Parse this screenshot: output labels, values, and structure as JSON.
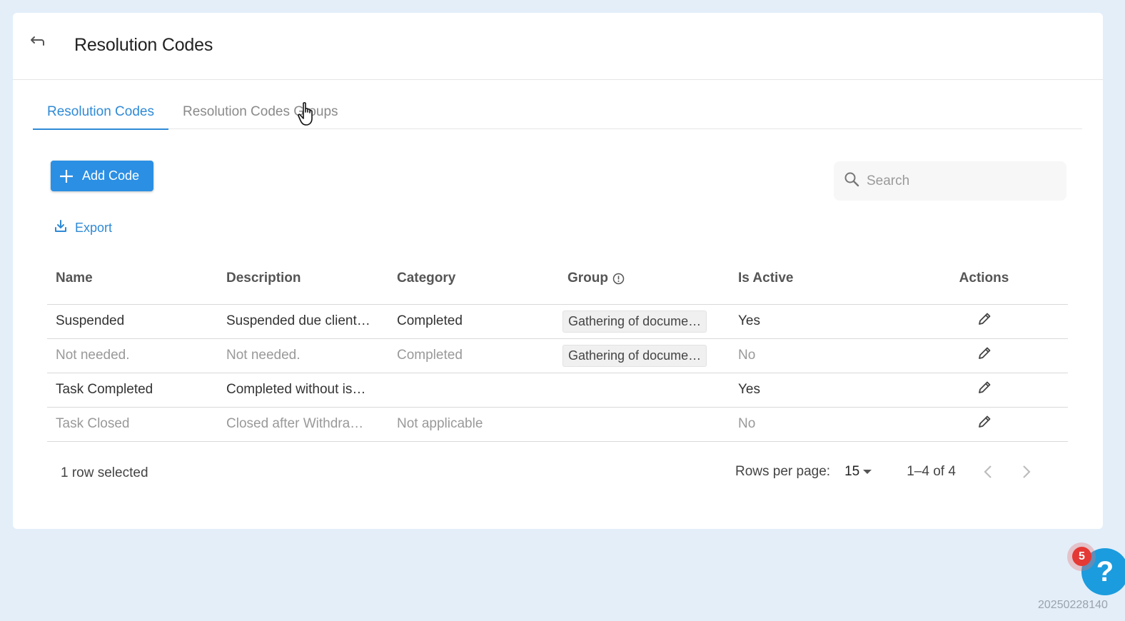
{
  "header": {
    "title": "Resolution Codes",
    "back_icon": "back-arrow-icon"
  },
  "tabs": [
    {
      "label": "Resolution Codes",
      "active": true
    },
    {
      "label": "Resolution Codes Groups",
      "active": false
    }
  ],
  "toolbar": {
    "add_label": "Add Code",
    "export_label": "Export",
    "search_placeholder": "Search"
  },
  "table": {
    "columns": [
      "Name",
      "Description",
      "Category",
      "Group",
      "Is Active",
      "Actions"
    ],
    "rows": [
      {
        "name": "Suspended",
        "description": "Suspended due client…",
        "category": "Completed",
        "group": "Gathering of docume…",
        "is_active": "Yes"
      },
      {
        "name": "Not needed.",
        "description": "Not needed.",
        "category": "Completed",
        "group": "Gathering of docume…",
        "is_active": "No"
      },
      {
        "name": "Task Completed",
        "description": "Completed without is…",
        "category": "",
        "group": "",
        "is_active": "Yes"
      },
      {
        "name": "Task Closed",
        "description": "Closed after Withdra…",
        "category": "Not applicable",
        "group": "",
        "is_active": "No"
      }
    ]
  },
  "footer": {
    "selection_text": "1 row selected",
    "rows_per_page_label": "Rows per page:",
    "rows_per_page_value": "15",
    "range_text": "1–4 of 4"
  },
  "help": {
    "badge_count": "5",
    "icon": "?"
  },
  "build_id": "20250228140",
  "colors": {
    "accent": "#2f8ad6",
    "button": "#2b8fe3",
    "background": "#e3eef9",
    "badge": "#e53935",
    "help": "#1b9cde"
  }
}
